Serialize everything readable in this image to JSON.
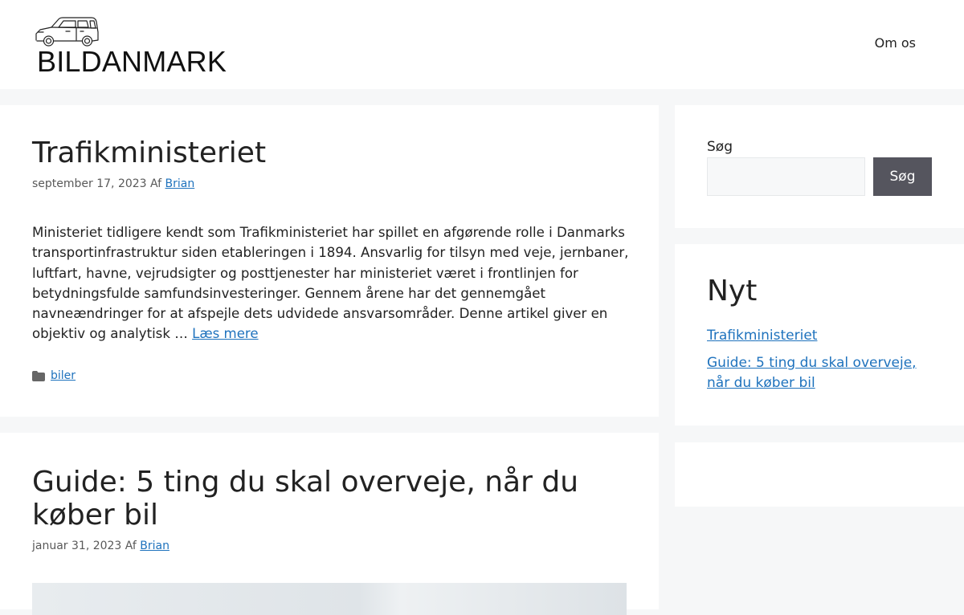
{
  "header": {
    "site_title": "BILDANMARK",
    "nav": [
      "Om os"
    ]
  },
  "posts": [
    {
      "title": "Trafikministeriet",
      "date": "september 17, 2023",
      "by": "Af",
      "author": "Brian",
      "summary": "Ministeriet tidligere kendt som Trafikministeriet har spillet en afgørende rolle i Danmarks transportinfrastruktur siden etableringen i 1894. Ansvarlig for tilsyn med veje, jernbaner, luftfart, havne, vejrudsigter og posttjenester har ministeriet været i frontlinjen for betydningsfulde samfundsinvesteringer. Gennem årene har det gennemgået navneændringer for at afspejle dets udvidede ansvarsområder. Denne artikel giver en objektiv og analytisk …",
      "read_more": "Læs mere",
      "category": "biler"
    },
    {
      "title": "Guide: 5 ting du skal overveje, når du køber bil",
      "date": "januar 31, 2023",
      "by": "Af",
      "author": "Brian"
    }
  ],
  "sidebar": {
    "search_label": "Søg",
    "search_button": "Søg",
    "search_value": "",
    "recent_title": "Nyt",
    "recent_posts": [
      "Trafikministeriet",
      "Guide: 5 ting du skal overveje, når du køber bil"
    ]
  },
  "colors": {
    "link": "#1e72bd",
    "button": "#55555e",
    "background": "#f6f7f8"
  }
}
